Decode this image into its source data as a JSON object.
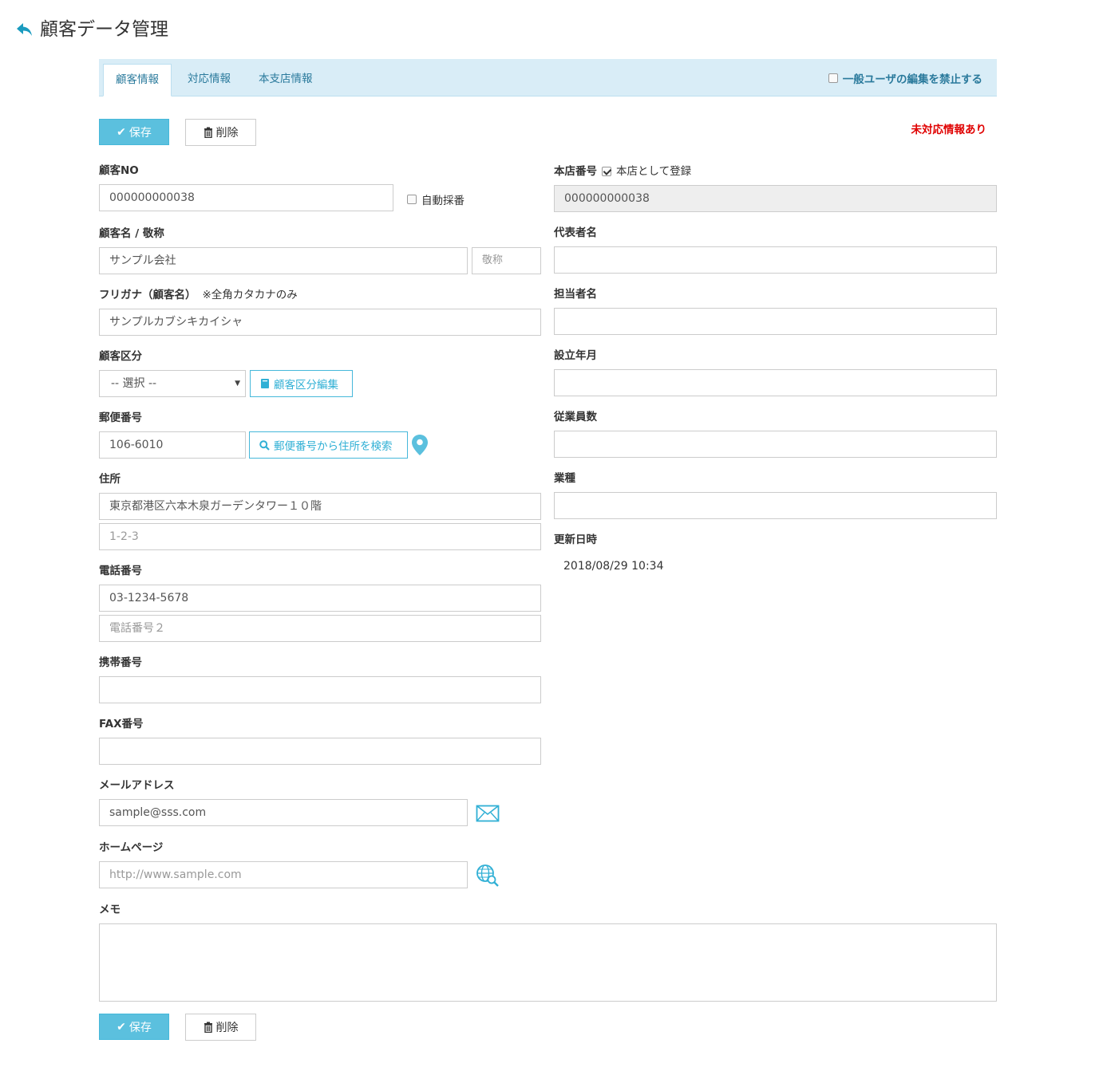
{
  "header": {
    "title": "顧客データ管理",
    "back_icon": "reply-arrow-icon"
  },
  "tabs": [
    {
      "label": "顧客情報",
      "active": true
    },
    {
      "label": "対応情報",
      "active": false
    },
    {
      "label": "本支店情報",
      "active": false
    }
  ],
  "lock_edit": {
    "label": "一般ユーザの編集を禁止する",
    "checked": false
  },
  "toolbar": {
    "save_label": "保存",
    "delete_label": "削除"
  },
  "alert": {
    "text": "未対応情報あり",
    "color": "#e00000"
  },
  "left": {
    "customer_no": {
      "label": "顧客NO",
      "value": "000000000038",
      "auto_label": "自動採番",
      "auto_checked": false
    },
    "customer_name": {
      "label": "顧客名 / 敬称",
      "value": "サンプル会社",
      "honorific_placeholder": "敬称"
    },
    "furigana": {
      "label": "フリガナ（顧客名）",
      "note": "※全角カタカナのみ",
      "value": "サンプルカブシキカイシャ"
    },
    "category": {
      "label": "顧客区分",
      "selected": "-- 選択 --",
      "edit_button": "顧客区分編集"
    },
    "postal": {
      "label": "郵便番号",
      "value": "106-6010",
      "search_button": "郵便番号から住所を検索"
    },
    "address": {
      "label": "住所",
      "line1": "東京都港区六本木泉ガーデンタワー１０階",
      "line2": "1-2-3"
    },
    "phone": {
      "label": "電話番号",
      "value": "03-1234-5678",
      "placeholder2": "電話番号２"
    },
    "mobile": {
      "label": "携帯番号",
      "value": ""
    },
    "fax": {
      "label": "FAX番号",
      "value": ""
    },
    "email": {
      "label": "メールアドレス",
      "value": "sample@sss.com"
    },
    "homepage": {
      "label": "ホームページ",
      "placeholder": "http://www.sample.com"
    },
    "memo": {
      "label": "メモ",
      "value": ""
    }
  },
  "right": {
    "head_office": {
      "label": "本店番号",
      "register_label": "本店として登録",
      "register_checked": true,
      "value": "000000000038"
    },
    "representative": {
      "label": "代表者名",
      "value": ""
    },
    "person_in_charge": {
      "label": "担当者名",
      "value": ""
    },
    "established": {
      "label": "設立年月",
      "value": ""
    },
    "employees": {
      "label": "従業員数",
      "value": ""
    },
    "industry": {
      "label": "業種",
      "value": ""
    },
    "updated": {
      "label": "更新日時",
      "value": "2018/08/29 10:34"
    }
  },
  "colors": {
    "accent": "#5bc0de",
    "tab_bg": "#d9edf7",
    "link": "#2a7a9c"
  }
}
